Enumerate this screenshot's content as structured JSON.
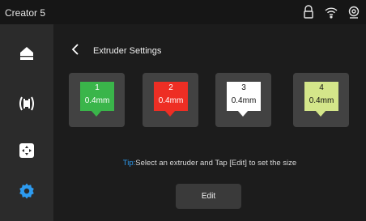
{
  "app": {
    "title": "Creator 5"
  },
  "status_bar": {
    "icons": [
      "lock-icon",
      "wifi-icon",
      "camera-icon"
    ]
  },
  "sidebar": {
    "items": [
      {
        "id": "home",
        "icon": "home-icon",
        "active": false
      },
      {
        "id": "print",
        "icon": "print-icon",
        "active": false
      },
      {
        "id": "control",
        "icon": "move-control-icon",
        "active": false
      },
      {
        "id": "settings",
        "icon": "gear-icon",
        "active": true,
        "accent": "#2d9bf0"
      }
    ]
  },
  "page": {
    "title": "Extruder Settings",
    "back_icon": "chevron-left-icon"
  },
  "extruders": [
    {
      "number": "1",
      "size": "0.4mm",
      "color": "#3ab54a",
      "text_color": "#ffffff",
      "arrow_color": "#3ab54a"
    },
    {
      "number": "2",
      "size": "0.4mm",
      "color": "#ee2e24",
      "text_color": "#ffffff",
      "arrow_color": "#ee2e24"
    },
    {
      "number": "3",
      "size": "0.4mm",
      "color": "#ffffff",
      "text_color": "#111111",
      "arrow_color": "#ffffff"
    },
    {
      "number": "4",
      "size": "0.4mm",
      "color": "#d4e68a",
      "text_color": "#111111",
      "arrow_color": "#d4e68a"
    }
  ],
  "tip": {
    "prefix": "Tip:",
    "text": "Select an extruder and Tap [Edit] to set the size",
    "accent": "#2d9bf0"
  },
  "edit_button": {
    "label": "Edit"
  }
}
